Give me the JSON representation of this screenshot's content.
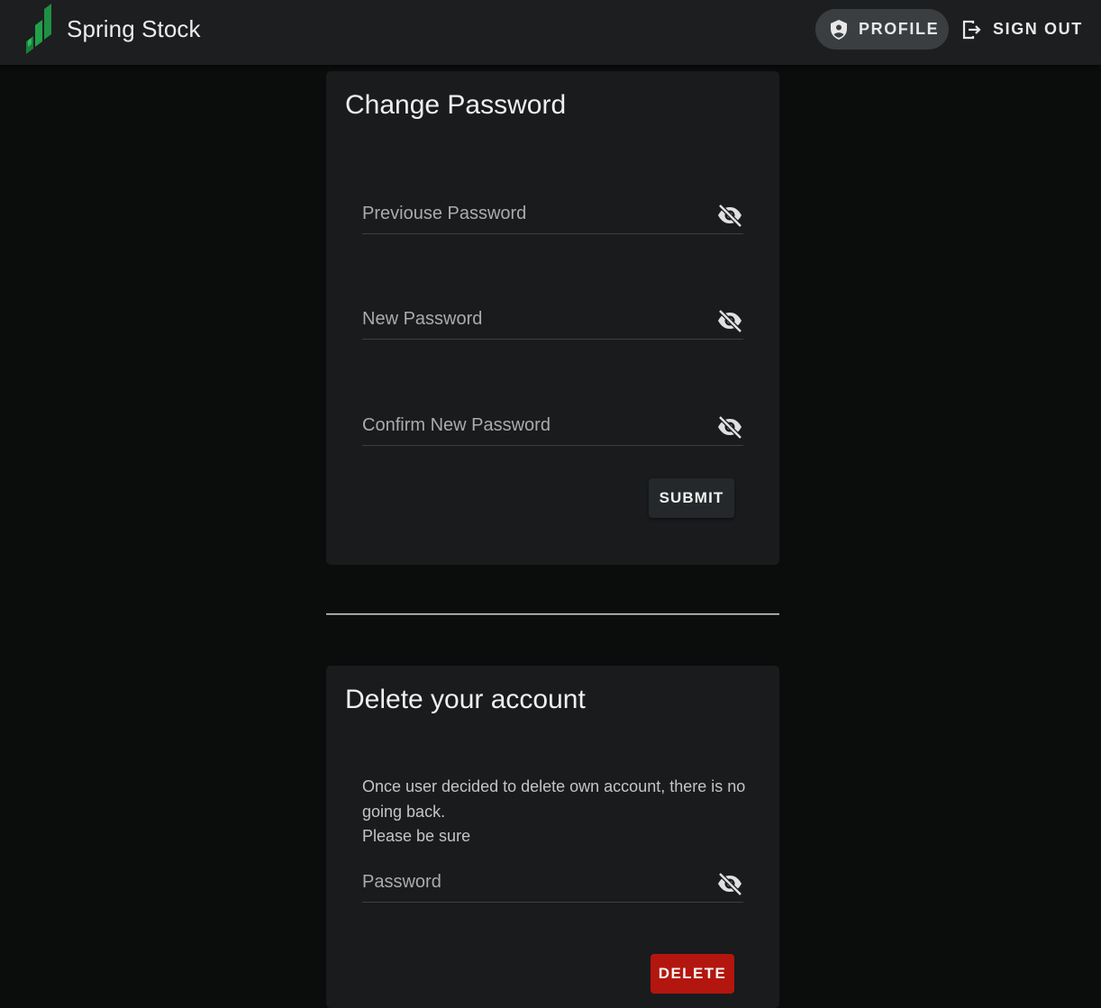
{
  "app": {
    "name": "Spring Stock",
    "brand_colors": [
      "#1a7f3c",
      "#22a04a",
      "#2dbb59"
    ]
  },
  "nav": {
    "profile_label": "PROFILE",
    "profile_icon": "shield-person-icon",
    "signout_label": "SIGN OUT",
    "signout_icon": "logout-icon"
  },
  "change_password": {
    "title": "Change Password",
    "previous_password": {
      "label": "Previouse Password",
      "value": "",
      "icon": "eye-off-icon"
    },
    "new_password": {
      "label": "New Password",
      "value": "",
      "icon": "eye-off-icon"
    },
    "confirm_password": {
      "label": "Confirm New Password",
      "value": "",
      "icon": "eye-off-icon"
    },
    "submit_label": "SUBMIT"
  },
  "delete_account": {
    "title": "Delete your account",
    "warning_line1": "Once user decided to delete own account, there is no going back.",
    "warning_line2": "Please be sure",
    "password": {
      "label": "Password",
      "value": "",
      "icon": "eye-off-icon"
    },
    "delete_label": "DELETE",
    "delete_color": "#b3160e"
  }
}
